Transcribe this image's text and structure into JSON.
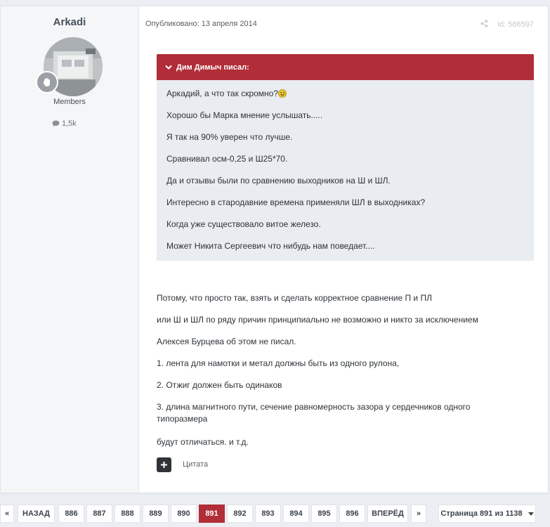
{
  "author": {
    "name": "Arkadi",
    "group": "Members",
    "reputation": "1,5k",
    "avatar_alt": "avatar",
    "rank_icon": "hand-badge-icon",
    "stat_icon": "comment-icon"
  },
  "post": {
    "published": "Опубликовано: 13 апреля 2014",
    "id": "id: 586597",
    "share_icon": "share-icon"
  },
  "quote": {
    "header": "Дим Димыч писал:",
    "lines": [
      "Аркадий, а что так скромно?",
      "Хорошо бы Марка мнение услышать.....",
      "Я так на 90% уверен что лучше.",
      "Сравнивал осм-0,25 и Ш25*70.",
      "Да и отзывы были по сравнению выходников на Ш и ШЛ.",
      "Интересно в стародавние времена применяли ШЛ в выходниках?",
      "Когда уже существовало витое железо.",
      "Может Никита Сергеевич что нибудь нам поведает...."
    ]
  },
  "content": {
    "paragraphs": [
      "Потому, что просто так, взять и сделать корректное сравнение П и ПЛ",
      "или Ш и ШЛ по ряду причин принципиально не возможно и никто за исключением",
      "Алексея Бурцева об этом не писал.",
      "1. лента для намотки и метал должны быть из одного рулона,",
      "2. Отжиг должен быть одинаков",
      "3. длина магнитного пути, сечение равномерность зазора у сердечников одного типоразмера",
      "будут отличаться. и т.д."
    ]
  },
  "actions": {
    "quote_label": "Цитата"
  },
  "pagination": {
    "first": "«",
    "prev": "НАЗАД",
    "pages": [
      "886",
      "887",
      "888",
      "889",
      "890",
      "891",
      "892",
      "893",
      "894",
      "895",
      "896"
    ],
    "current": "891",
    "next": "ВПЕРЁД",
    "last": "»",
    "jump": "Страница 891 из 1138"
  },
  "colors": {
    "accent": "#b12e38",
    "quote_bg": "#e9ecf0",
    "sidebar_bg": "#f4f6f8"
  }
}
